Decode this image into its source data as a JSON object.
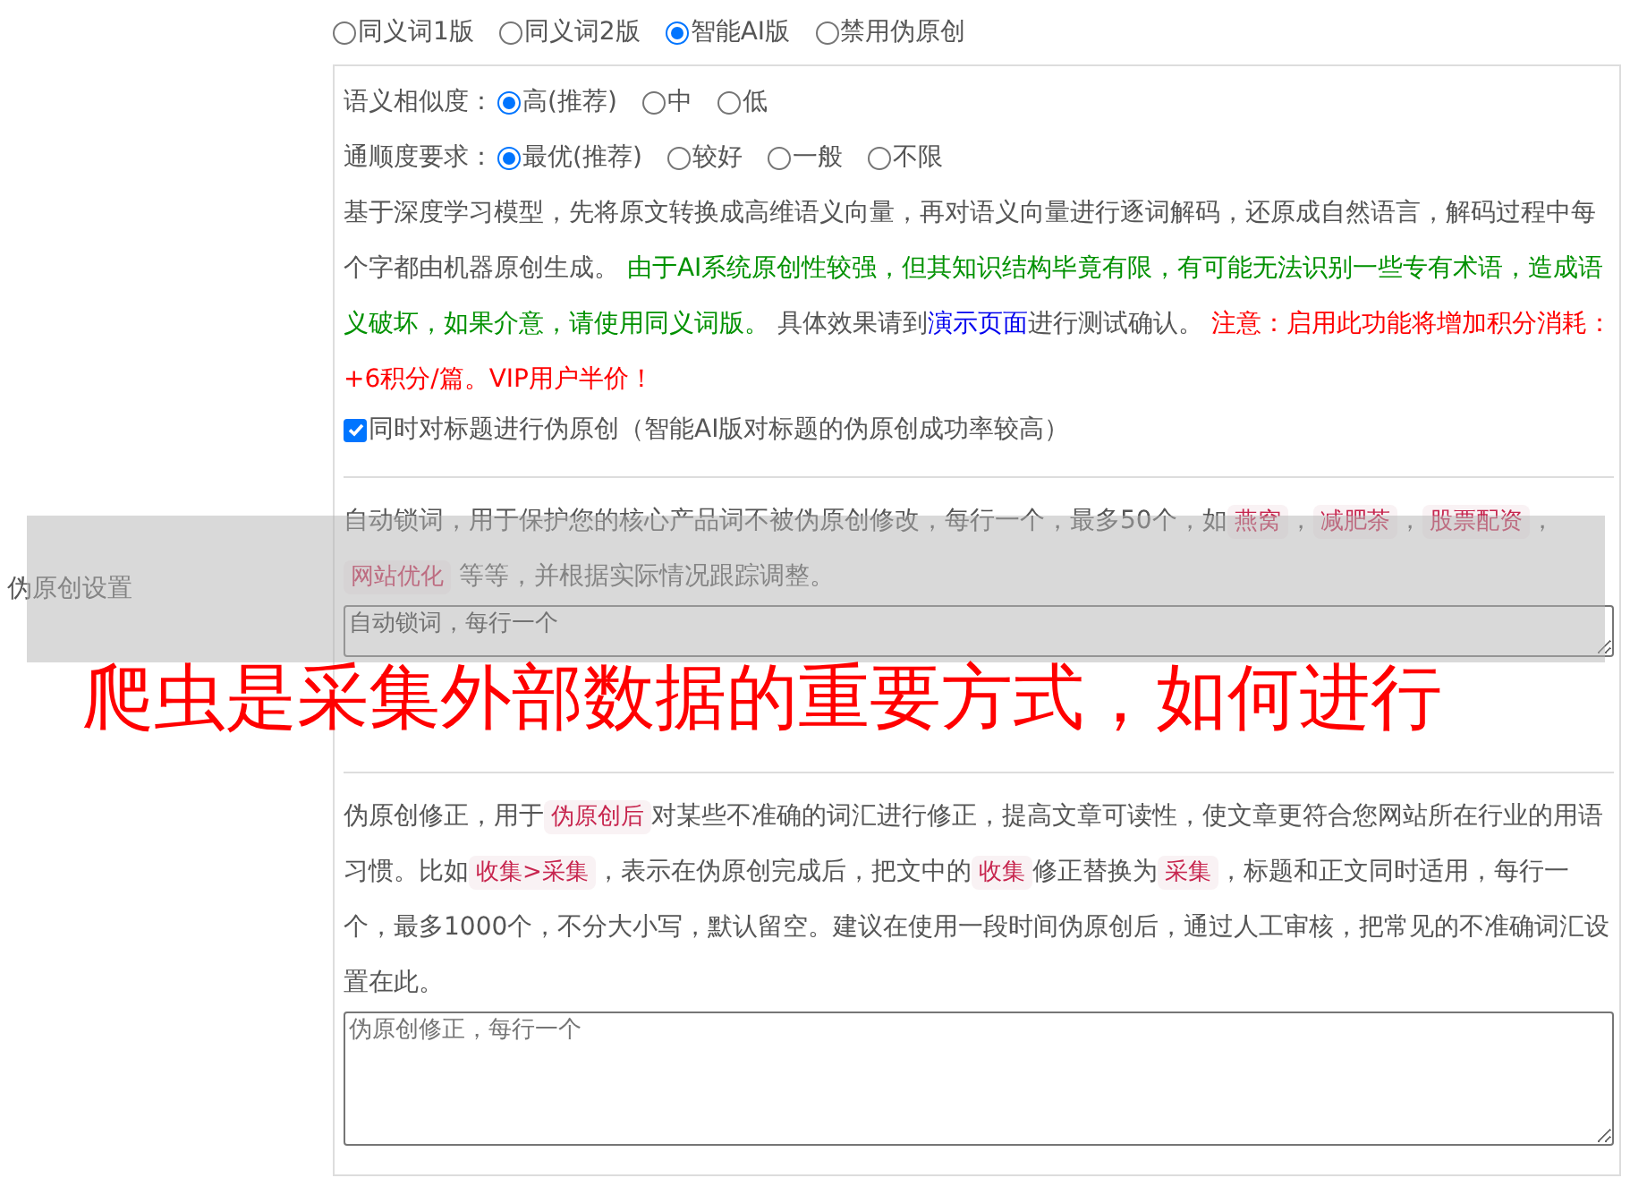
{
  "sidebar_label": "伪原创设置",
  "mode_options": [
    {
      "label": "同义词1版",
      "selected": false
    },
    {
      "label": "同义词2版",
      "selected": false
    },
    {
      "label": "智能AI版",
      "selected": true
    },
    {
      "label": "禁用伪原创",
      "selected": false
    }
  ],
  "similarity": {
    "label": "语义相似度：",
    "options": [
      {
        "label": "高(推荐)",
        "selected": true
      },
      {
        "label": "中",
        "selected": false
      },
      {
        "label": "低",
        "selected": false
      }
    ]
  },
  "fluency": {
    "label": "通顺度要求：",
    "options": [
      {
        "label": "最优(推荐)",
        "selected": true
      },
      {
        "label": "较好",
        "selected": false
      },
      {
        "label": "一般",
        "selected": false
      },
      {
        "label": "不限",
        "selected": false
      }
    ]
  },
  "ai_description": [
    {
      "kind": "text",
      "text": "基于深度学习模型，先将原文转换成高维语义向量，再对语义向量进行逐词解码，还原成自然语言，解码过程中每个字都由机器原创生成。 "
    },
    {
      "kind": "note",
      "text": "由于AI系统原创性较强，但其知识结构毕竟有限，有可能无法识别一些专有术语，造成语义破坏，如果介意，请使用同义词版。"
    },
    {
      "kind": "text",
      "text": " 具体效果请到"
    },
    {
      "kind": "link",
      "text": "演示页面"
    },
    {
      "kind": "text",
      "text": "进行测试确认。 "
    },
    {
      "kind": "warning",
      "text": "注意：启用此功能将增加积分消耗：+6积分/篇。VIP用户半价！"
    }
  ],
  "title_checkbox": {
    "label": "同时对标题进行伪原创（智能AI版对标题的伪原创成功率较高）",
    "checked": true
  },
  "lock_words": {
    "description": [
      {
        "kind": "text",
        "text": "自动锁词，用于保护您的核心产品词不被伪原创修改，每行一个，最多50个，如"
      },
      {
        "kind": "tag",
        "text": "燕窝"
      },
      {
        "kind": "text",
        "text": "，"
      },
      {
        "kind": "tag",
        "text": "减肥茶"
      },
      {
        "kind": "text",
        "text": "，"
      },
      {
        "kind": "tag",
        "text": "股票配资"
      },
      {
        "kind": "text",
        "text": "，"
      },
      {
        "kind": "tag",
        "text": "网站优化"
      },
      {
        "kind": "text",
        "text": " 等等，并根据实际情况跟踪调整。"
      }
    ],
    "field": {
      "placeholder": "自动锁词，每行一个"
    }
  },
  "corrections": {
    "description": [
      {
        "kind": "text",
        "text": "伪原创修正，用于"
      },
      {
        "kind": "tag",
        "text": "伪原创后"
      },
      {
        "kind": "text",
        "text": "对某些不准确的词汇进行修正，提高文章可读性，使文章更符合您网站所在行业的用语习惯。比如"
      },
      {
        "kind": "tag",
        "text": "收集>采集"
      },
      {
        "kind": "text",
        "text": "，表示在伪原创完成后，把文中的"
      },
      {
        "kind": "tag",
        "text": "收集"
      },
      {
        "kind": "text",
        "text": "修正替换为"
      },
      {
        "kind": "tag",
        "text": "采集"
      },
      {
        "kind": "text",
        "text": "，标题和正文同时适用，每行一个，最多1000个，不分大小写，默认留空。建议在使用一段时间伪原创后，通过人工审核，把常见的不准确词汇设置在此。"
      }
    ],
    "field": {
      "placeholder": "伪原创修正，每行一个"
    }
  },
  "overlay_caption": "爬虫是采集外部数据的重要方式，如何进行"
}
